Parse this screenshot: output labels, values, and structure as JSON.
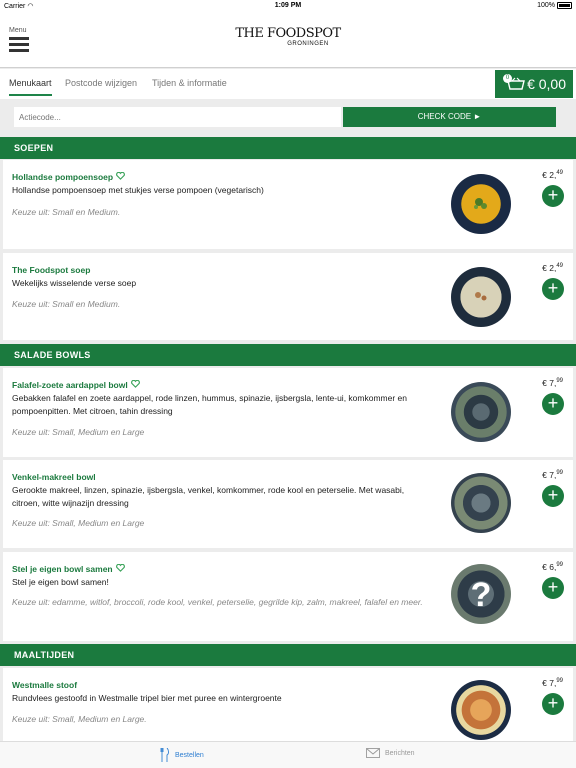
{
  "status_bar": {
    "carrier": "Carrier",
    "time": "1:09 PM",
    "battery": "100%"
  },
  "header": {
    "menu_label": "Menu",
    "logo_main": "THE FOODSPOT",
    "logo_sub": "GRONINGEN"
  },
  "tabs": [
    {
      "label": "Menukaart",
      "active": true
    },
    {
      "label": "Postcode wijzigen",
      "active": false
    },
    {
      "label": "Tijden & informatie",
      "active": false
    }
  ],
  "cart": {
    "count": "0",
    "total": "€ 0,00"
  },
  "code": {
    "placeholder": "Actiecode...",
    "button_label": "CHECK CODE  ►"
  },
  "sections": [
    {
      "title": "SOEPEN"
    },
    {
      "title": "SALADE BOWLS"
    },
    {
      "title": "MAALTIJDEN"
    }
  ],
  "items": [
    {
      "name": "Hollandse pompoensoep",
      "vegetarian": true,
      "desc": "Hollandse pompoensoep met stukjes verse pompoen (vegetarisch)",
      "choice": "Keuze uit: Small en Medium.",
      "price_main": "€ 2,",
      "price_cents": "49",
      "image": "pumpkin-soup"
    },
    {
      "name": "The Foodspot soep",
      "vegetarian": false,
      "desc": "Wekelijks wisselende verse soep",
      "choice": "Keuze uit: Small en Medium.",
      "price_main": "€ 2,",
      "price_cents": "49",
      "image": "cream-soup"
    },
    {
      "name": "Falafel-zoete aardappel bowl",
      "vegetarian": true,
      "desc": "Gebakken falafel en zoete aardappel, rode linzen, hummus, spinazie, ijsbergsla, lente-ui, komkommer en pompoenpitten. Met citroen, tahin dressing",
      "choice": "Keuze uit: Small, Medium en Large",
      "price_main": "€ 7,",
      "price_cents": "99",
      "image": "salad-bowl"
    },
    {
      "name": "Venkel-makreel bowl",
      "vegetarian": false,
      "desc": "Gerookte makreel, linzen, spinazie, ijsbergsla, venkel, komkommer, rode kool en peterselie. Met wasabi, citroen, witte wijnazijn dressing",
      "choice": "Keuze uit: Small, Medium en Large",
      "price_main": "€ 7,",
      "price_cents": "99",
      "image": "salad-bowl"
    },
    {
      "name": "Stel je eigen bowl samen",
      "vegetarian": true,
      "desc": "Stel je eigen bowl samen!",
      "choice": "Keuze uit: edamme, witlof, broccoli, rode kool, venkel, peterselie, gegrilde kip, zalm, makreel, falafel en meer.",
      "price_main": "€ 6,",
      "price_cents": "99",
      "image": "custom-bowl"
    },
    {
      "name": "Westmalle stoof",
      "vegetarian": false,
      "desc": "Rundvlees gestoofd in Westmalle tripel bier met puree en wintergroente",
      "choice": "Keuze uit: Small, Medium en Large.",
      "price_main": "€ 7,",
      "price_cents": "99",
      "image": "stew-plate"
    }
  ],
  "bottom_nav": [
    {
      "label": "Bestellen",
      "active": true,
      "icon": "cutlery-icon"
    },
    {
      "label": "Berichten",
      "active": false,
      "icon": "envelope-icon"
    }
  ],
  "colors": {
    "brand_green": "#1b7a3e",
    "active_blue": "#2f7fd1"
  }
}
